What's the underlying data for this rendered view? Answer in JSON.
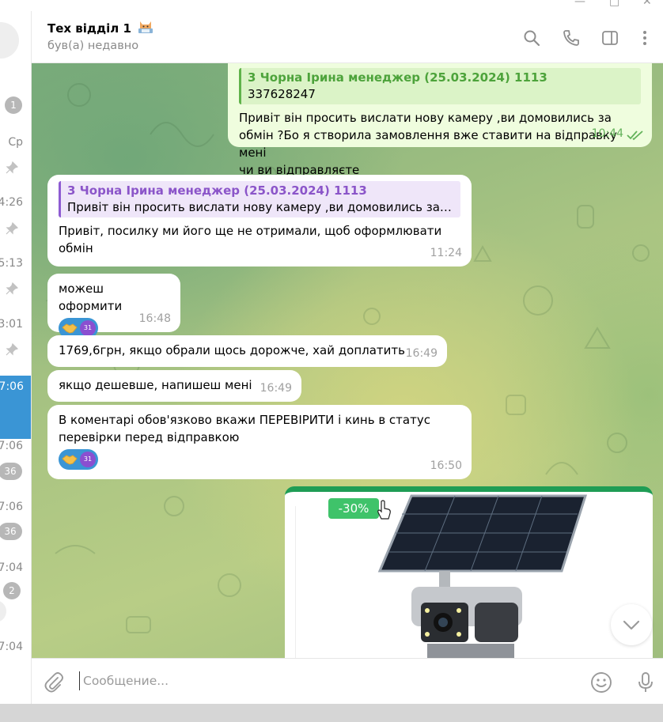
{
  "window": {
    "minimize": "—",
    "maximize": "□",
    "close": "✕"
  },
  "chat_list": {
    "items": [
      {
        "badge": "1"
      },
      {
        "time": "Ср"
      },
      {
        "time": "4:26"
      },
      {
        "time": "5:13"
      },
      {
        "time": "3:01"
      },
      {
        "time": "7:06"
      },
      {
        "time": "7:06",
        "badge": "36"
      },
      {
        "time": "7:06",
        "badge": "36"
      },
      {
        "time": "7:04",
        "badge": "2"
      },
      {
        "time": "7:04"
      }
    ]
  },
  "header": {
    "title": "Тех відділ 1",
    "status": "був(а) недавно"
  },
  "messages": [
    {
      "direction": "out",
      "reply_name": "3 Чорна Ірина менеджер (25.03.2024) 1113",
      "reply_text": "337628247",
      "text_lines": [
        "Привіт він просить вислати нову камеру ,ви домовились за",
        "обмін ?Бо я створила замовлення вже ставити на відправку мені",
        "чи ви відправляєте"
      ],
      "time": "10:44"
    },
    {
      "direction": "in",
      "reply_name": "3 Чорна Ірина менеджер (25.03.2024) 1113",
      "reply_text": "Привіт він просить вислати нову камеру ,ви домовились за о...",
      "text_lines": [
        "Привіт, посилку ми його ще не отримали, щоб оформлювати",
        "обмін"
      ],
      "time": "11:24"
    },
    {
      "direction": "in",
      "text": "можеш оформити",
      "time": "16:48",
      "reaction_user": "31"
    },
    {
      "direction": "in",
      "text": "1769,6грн, якщо обрали щось дорожче, хай доплатить",
      "time": "16:49"
    },
    {
      "direction": "in",
      "text": "якщо дешевше, напишеш мені",
      "time": "16:49"
    },
    {
      "direction": "in",
      "text_lines": [
        "В коментарі обов'язково вкажи ПЕРЕВІРИТИ і кинь в статус",
        "перевірки перед відправкою"
      ],
      "time": "16:50",
      "reaction_user": "31"
    }
  ],
  "photo": {
    "discount": "-30%"
  },
  "composer": {
    "placeholder": "Сообщение..."
  },
  "colors": {
    "accent": "#3a95d5",
    "out_bubble": "#effdde",
    "green_reply": "#4da33b",
    "purple_reply": "#8b55c9",
    "discount": "#3fc36a"
  }
}
